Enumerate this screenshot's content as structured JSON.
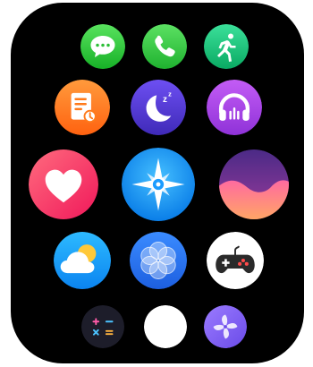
{
  "screen": "watch-app-grid",
  "apps": [
    {
      "id": "a1",
      "icon": "message-icon",
      "color": "#2fc83b"
    },
    {
      "id": "a2",
      "icon": "phone-icon",
      "color": "#33c742"
    },
    {
      "id": "a3",
      "icon": "running-icon",
      "color": "#15c27e"
    },
    {
      "id": "b1",
      "icon": "notes-icon",
      "color": "#ff7a1a"
    },
    {
      "id": "b2",
      "icon": "sleep-icon",
      "color": "#5a3fe0"
    },
    {
      "id": "b3",
      "icon": "headphones-icon",
      "color": "#b04ae8"
    },
    {
      "id": "c1",
      "icon": "heart-icon",
      "color": "#ff3e6a"
    },
    {
      "id": "c2",
      "icon": "compass-icon",
      "color": "#1c9cff"
    },
    {
      "id": "c3",
      "icon": "wave-icon",
      "color": "#f34e8a"
    },
    {
      "id": "d1",
      "icon": "weather-icon",
      "color": "#1aa4ff"
    },
    {
      "id": "d2",
      "icon": "flower-icon",
      "color": "#2b72f0"
    },
    {
      "id": "d3",
      "icon": "gamepad-icon",
      "color": "#ffffff"
    },
    {
      "id": "e1",
      "icon": "calculator-icon",
      "color": "#1d1d2a"
    },
    {
      "id": "e2",
      "icon": "voice-recorder-icon",
      "color": "#ffffff"
    },
    {
      "id": "e3",
      "icon": "pinwheel-icon",
      "color": "#8a6cff"
    }
  ]
}
